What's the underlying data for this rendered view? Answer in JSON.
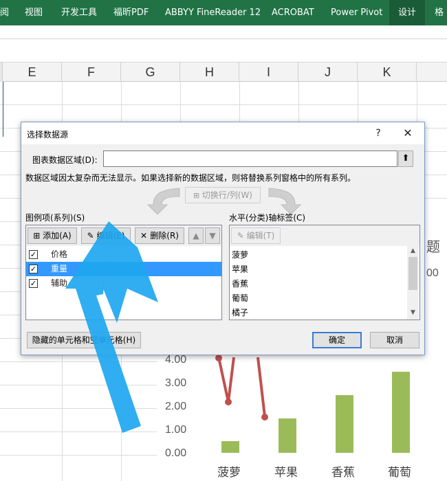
{
  "ribbon": {
    "tabs": [
      {
        "label": "阅",
        "active": false
      },
      {
        "label": "视图",
        "active": false
      },
      {
        "label": "开发工具",
        "active": false
      },
      {
        "label": "福昕PDF",
        "active": false
      },
      {
        "label": "ABBYY FineReader 12",
        "active": false
      },
      {
        "label": "ACROBAT",
        "active": false
      },
      {
        "label": "Power Pivot",
        "active": false
      },
      {
        "label": "设计",
        "active": true
      },
      {
        "label": "格",
        "active": false
      }
    ],
    "color": "#217346"
  },
  "grid": {
    "columns": [
      "E",
      "F",
      "G",
      "H",
      "I",
      "J",
      "K"
    ]
  },
  "chart": {
    "title_fragment": "题",
    "right_fragment": "00",
    "y_ticks": [
      "4.00",
      "3.00",
      "2.00",
      "1.00",
      "0.00"
    ],
    "categories": [
      "菠萝",
      "苹果",
      "香蕉",
      "葡萄"
    ],
    "bar_color": "#9bbb59",
    "line_color": "#c0504d"
  },
  "chart_data": {
    "type": "bar",
    "categories": [
      "菠萝",
      "苹果",
      "香蕉",
      "葡萄"
    ],
    "series": [
      {
        "values": [
          0.5,
          1.5,
          2.5,
          3.5
        ]
      }
    ],
    "ylim": [
      0,
      4
    ],
    "y_ticks": [
      "4.00",
      "3.00",
      "2.00",
      "1.00",
      "0.00"
    ]
  },
  "dialog": {
    "title": "选择数据源",
    "help": "?",
    "close": "✕",
    "range_label": "图表数据区域(D):",
    "range_value": "",
    "info": "数据区域因太复杂而无法显示。如果选择新的数据区域，则将替换系列窗格中的所有系列。",
    "switch_label": "切换行/列(W)",
    "legend_label": "图例项(系列)(S)",
    "add_label": "添加(A)",
    "edit_label": "编辑(E)",
    "delete_label": "删除(R)",
    "series": [
      {
        "name": "价格",
        "checked": true,
        "selected": false
      },
      {
        "name": "重量",
        "checked": true,
        "selected": true
      },
      {
        "name": "辅助",
        "checked": true,
        "selected": false
      }
    ],
    "axis_label": "水平(分类)轴标签(C)",
    "axis_edit_label": "编辑(T)",
    "categories": [
      "菠萝",
      "苹果",
      "香蕉",
      "葡萄",
      "橘子"
    ],
    "hidden_cells_label": "隐藏的单元格和空单元格(H)",
    "ok_label": "确定",
    "cancel_label": "取消"
  },
  "annotation": {
    "arrow_color": "#1ea7f0"
  }
}
